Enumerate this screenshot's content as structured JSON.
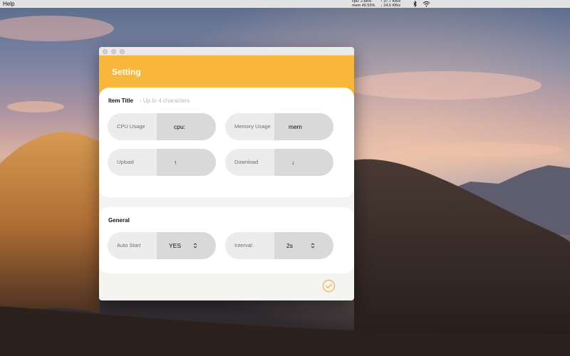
{
  "menubar": {
    "help_label": "Help",
    "stats": {
      "cpu": "cpu: 2.88%",
      "mem": "mem 49.55%",
      "upload": "↑ 37.7 KB/s",
      "download": "↓ 24.6 KB/s"
    },
    "icons": [
      "bluetooth-icon",
      "wifi-icon"
    ]
  },
  "window": {
    "title": "Setting",
    "accent_color": "#f8b63a",
    "item_title_section": {
      "title": "Item Title",
      "hint": "- Up to 4 characters",
      "fields": [
        {
          "label": "CPU Usage",
          "value": "cpu:"
        },
        {
          "label": "Memory Usage",
          "value": "mem"
        },
        {
          "label": "Upload",
          "value": "↑"
        },
        {
          "label": "Download",
          "value": "↓"
        }
      ]
    },
    "general_section": {
      "title": "General",
      "fields": [
        {
          "label": "Auto Start",
          "value": "YES"
        },
        {
          "label": "Interval:",
          "value": "2s"
        }
      ]
    },
    "confirm_icon": "checkmark-circle-icon"
  }
}
